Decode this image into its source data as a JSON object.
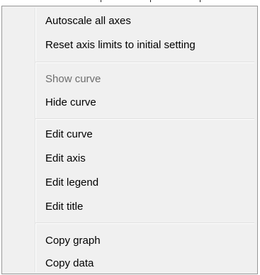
{
  "menu": {
    "items": [
      {
        "label": "Autoscale all axes",
        "enabled": true
      },
      {
        "label": "Reset axis limits to initial setting",
        "enabled": true
      },
      {
        "label": "Show curve",
        "enabled": false
      },
      {
        "label": "Hide curve",
        "enabled": true
      },
      {
        "label": "Edit curve",
        "enabled": true
      },
      {
        "label": "Edit axis",
        "enabled": true
      },
      {
        "label": "Edit legend",
        "enabled": true
      },
      {
        "label": "Edit title",
        "enabled": true
      },
      {
        "label": "Copy graph",
        "enabled": true
      },
      {
        "label": "Copy data",
        "enabled": true
      }
    ],
    "colors": {
      "background": "#f0f0f0",
      "border": "#979797",
      "text": "#000000",
      "disabled_text": "#6d6d6d"
    }
  }
}
